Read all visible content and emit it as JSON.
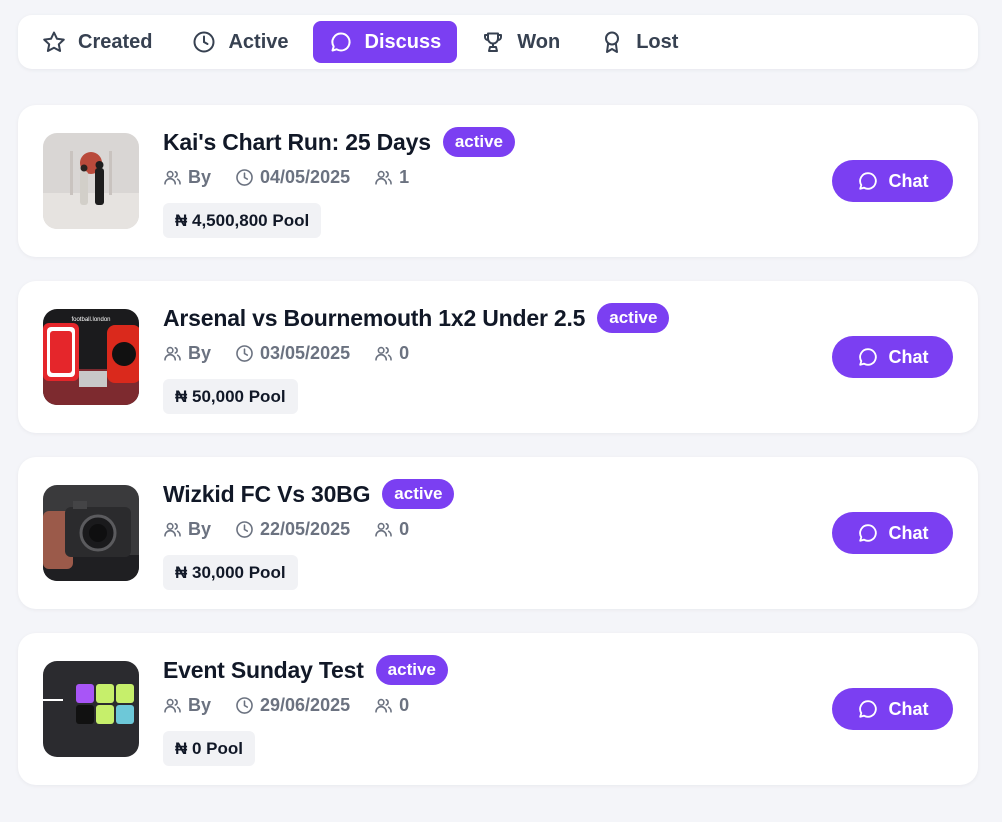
{
  "tabs": [
    {
      "label": "Created",
      "icon": "star-icon"
    },
    {
      "label": "Active",
      "icon": "clock-icon"
    },
    {
      "label": "Discuss",
      "icon": "chat-bubble-icon",
      "selected": true
    },
    {
      "label": "Won",
      "icon": "trophy-icon"
    },
    {
      "label": "Lost",
      "icon": "award-ribbon-icon"
    }
  ],
  "events": [
    {
      "title": "Kai's Chart Run: 25 Days",
      "status": "active",
      "by_label": "By",
      "date": "04/05/2025",
      "participants": "1",
      "pool": "₦ 4,500,800 Pool",
      "chat_label": "Chat"
    },
    {
      "title": "Arsenal vs Bournemouth 1x2 Under 2.5",
      "status": "active",
      "by_label": "By",
      "date": "03/05/2025",
      "participants": "0",
      "pool": "₦ 50,000 Pool",
      "chat_label": "Chat",
      "thumb_text": "football.london"
    },
    {
      "title": "Wizkid FC Vs 30BG",
      "status": "active",
      "by_label": "By",
      "date": "22/05/2025",
      "participants": "0",
      "pool": "₦ 30,000 Pool",
      "chat_label": "Chat"
    },
    {
      "title": "Event Sunday Test",
      "status": "active",
      "by_label": "By",
      "date": "29/06/2025",
      "participants": "0",
      "pool": "₦ 0 Pool",
      "chat_label": "Chat"
    }
  ],
  "colors": {
    "accent": "#7b3ff2",
    "background": "#f4f5f9",
    "card": "#ffffff",
    "muted_text": "#6b7280"
  }
}
